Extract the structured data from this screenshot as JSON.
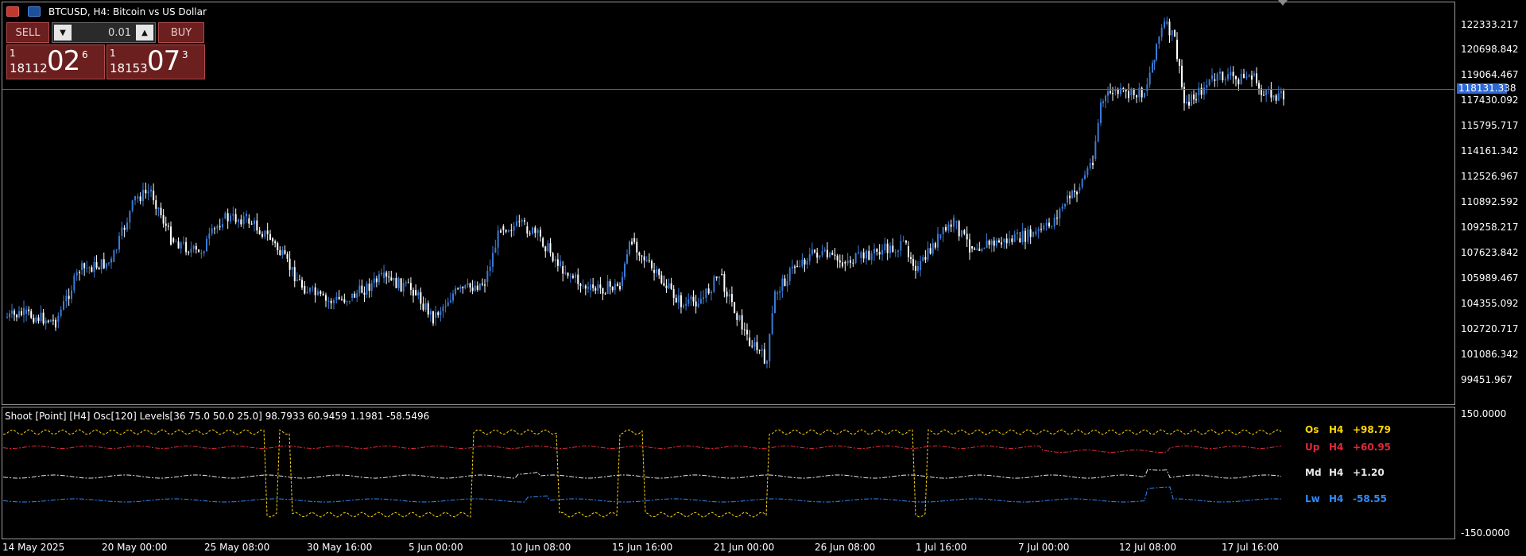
{
  "window": {
    "title": "BTCUSD, H4:  Bitcoin vs US Dollar"
  },
  "trade_panel": {
    "sell_label": "SELL",
    "buy_label": "BUY",
    "lot_value": "0.01",
    "sell_price": {
      "one": "1",
      "prefix": "18112",
      "big": "02",
      "sup": "6"
    },
    "buy_price": {
      "one": "1",
      "prefix": "18153",
      "big": "07",
      "sup": "3"
    }
  },
  "price_axis": {
    "labels": [
      "122333.217",
      "120698.842",
      "119064.467",
      "117430.092",
      "115795.717",
      "114161.342",
      "112526.967",
      "110892.592",
      "109258.217",
      "107623.842",
      "105989.467",
      "104355.092",
      "102720.717",
      "101086.342",
      "99451.967"
    ],
    "current_price": "118131.338"
  },
  "time_axis": {
    "labels": [
      "14 May 2025",
      "20 May 00:00",
      "25 May 08:00",
      "30 May 16:00",
      "5 Jun 00:00",
      "10 Jun 08:00",
      "15 Jun 16:00",
      "21 Jun 00:00",
      "26 Jun 08:00",
      "1 Jul 16:00",
      "7 Jul 00:00",
      "12 Jul 08:00",
      "17 Jul 16:00"
    ]
  },
  "oscillator": {
    "header": "Shoot [Point] [H4]  Osc[120]  Levels[36 75.0 50.0 25.0] 98.7933 60.9459 1.1981 -58.5496",
    "axis_labels": [
      "150.0000",
      "-150.0000"
    ],
    "rows": [
      {
        "name": "Os",
        "tf": "H4",
        "value": "+98.79",
        "color": "#ffd700"
      },
      {
        "name": "Up",
        "tf": "H4",
        "value": "+60.95",
        "color": "#e0283c"
      },
      {
        "name": "Md",
        "tf": "H4",
        "value": "+1.20",
        "color": "#e8e8e8"
      },
      {
        "name": "Lw",
        "tf": "H4",
        "value": "-58.55",
        "color": "#2e8bff"
      }
    ]
  },
  "colors": {
    "background": "#000000",
    "bull_candle": "#3a7bd5",
    "bear_candle": "#ffffff",
    "current_price_line": "#3d63c8"
  }
}
